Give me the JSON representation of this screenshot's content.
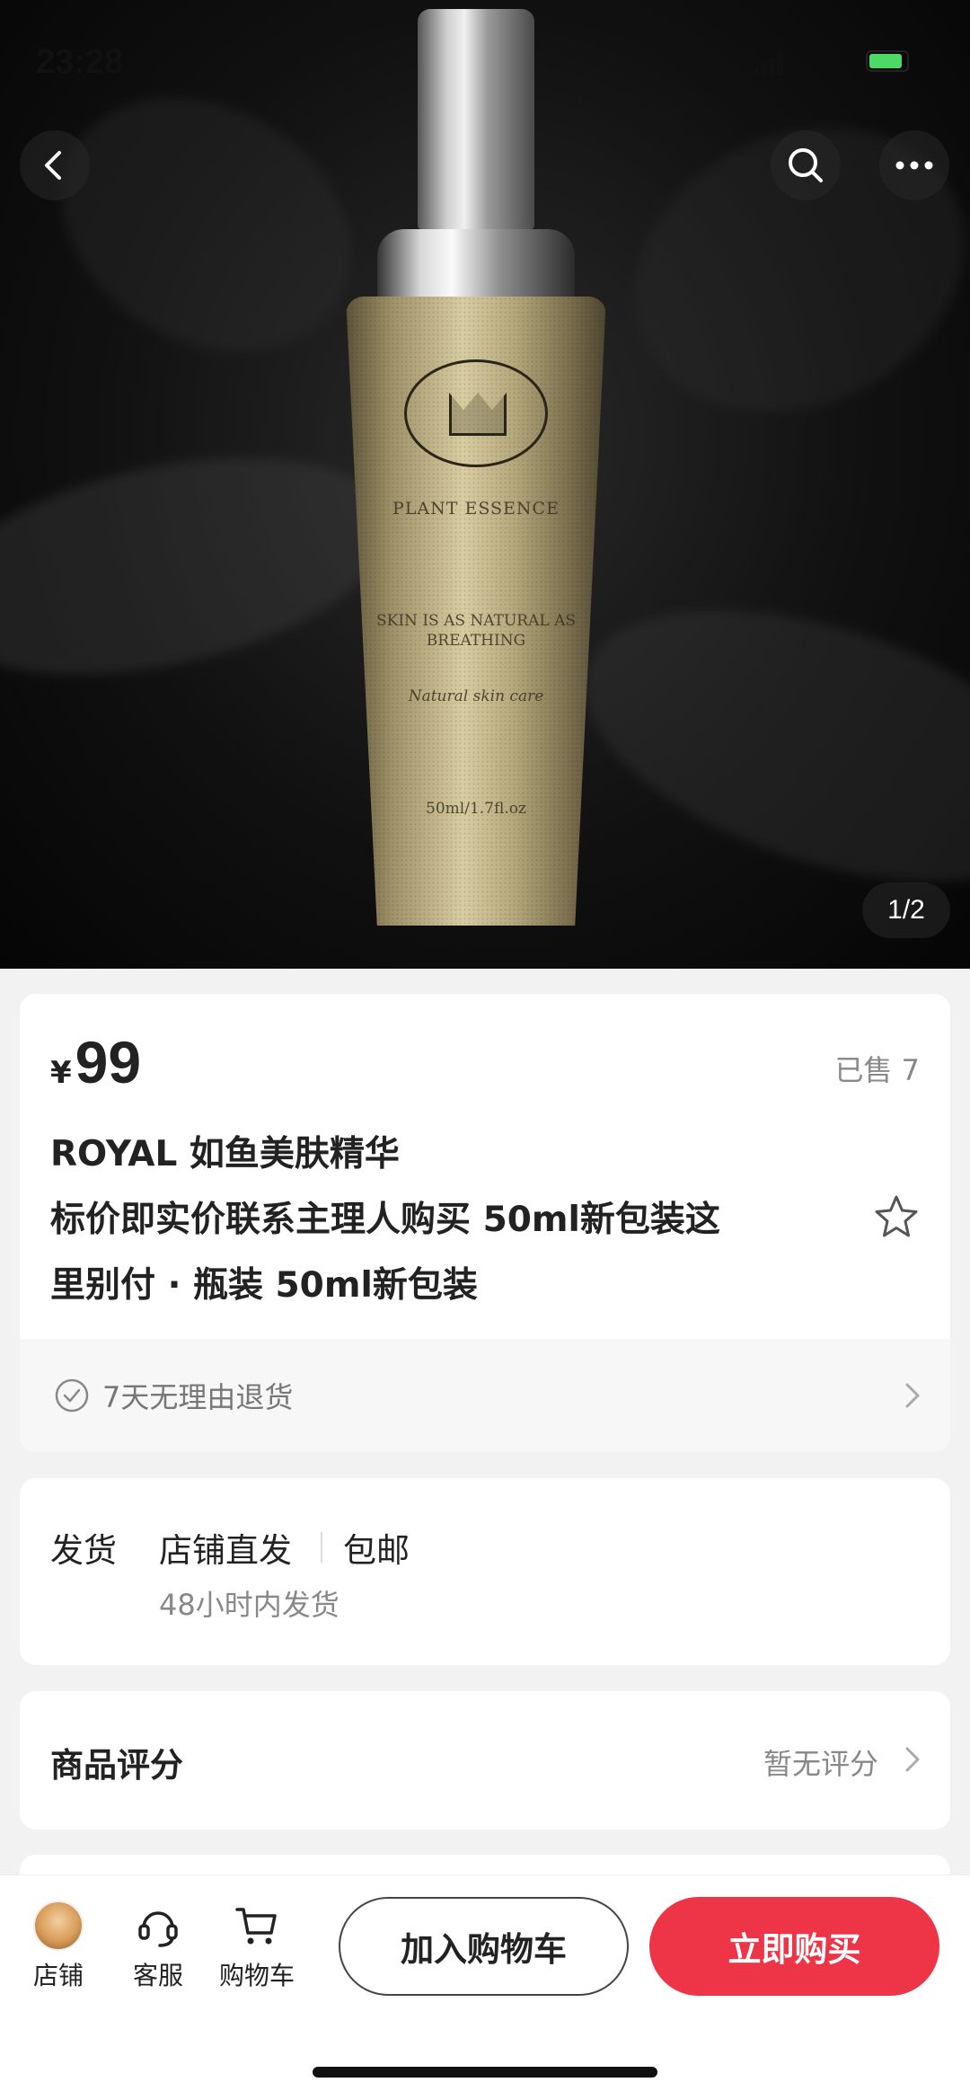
{
  "status_bar": {
    "time": "23:28"
  },
  "hero": {
    "counter": "1/2",
    "bottle_lines": {
      "brand": "PLANT ESSENCE",
      "slogan_1": "SKIN IS AS NATURAL AS",
      "slogan_2": "BREATHING",
      "subtitle": "Natural skin care",
      "volume": "50ml/1.7fl.oz"
    }
  },
  "nav": {
    "back_icon": "chevron-left-icon",
    "search_icon": "search-icon",
    "more_icon": "more-horizontal-icon"
  },
  "product": {
    "currency": "¥",
    "price": "99",
    "sold": "已售 7",
    "title_line_1": "ROYAL 如鱼美肤精华",
    "title_line_2": "标价即实价联系主理人购买 50ml新包装这",
    "title_line_3": "里别付 · 瓶装 50ml新包装",
    "return_policy": "7天无理由退货"
  },
  "shipping": {
    "label": "发货",
    "method": "店铺直发",
    "fee": "包邮",
    "time": "48小时内发货"
  },
  "reviews": {
    "title": "商品评分",
    "status": "暂无评分"
  },
  "bottom_bar": {
    "store_label": "店铺",
    "service_label": "客服",
    "cart_label": "购物车",
    "add_to_cart": "加入购物车",
    "buy_now": "立即购买",
    "buy_color": "#ee3447"
  }
}
